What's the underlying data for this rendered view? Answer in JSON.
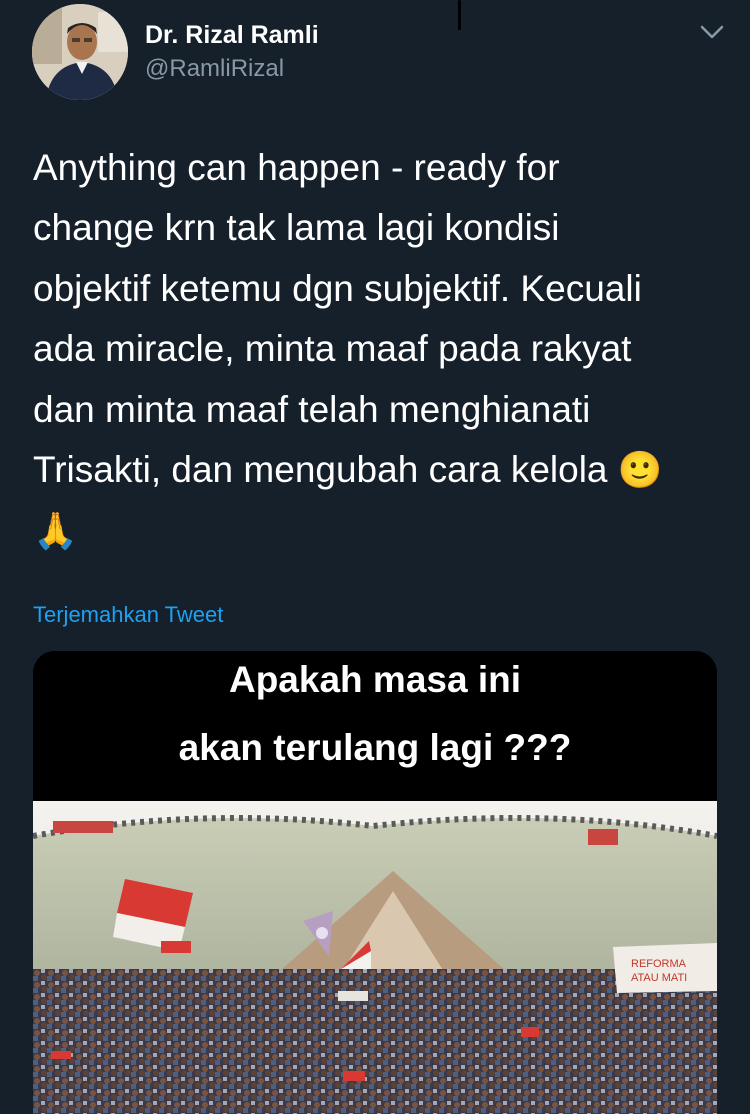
{
  "author": {
    "name": "Dr. Rizal Ramli",
    "handle": "@RamliRizal",
    "avatar_icon": "profile-photo"
  },
  "menu": {
    "icon": "chevron-down-icon"
  },
  "tweet": {
    "lines": [
      "Anything can happen - ready for",
      "change krn tak lama lagi kondisi",
      "objektif ketemu dgn subjektif. Kecuali",
      "ada miracle, minta maaf pada rakyat",
      "dan minta maaf telah menghianati",
      "Trisakti, dan mengubah cara kelola"
    ],
    "emoji_smile": "🙂",
    "emoji_pray": "🙏"
  },
  "translate_label": "Terjemahkan Tweet",
  "media": {
    "caption_line1": "Apakah masa ini",
    "caption_line2": "akan terulang lagi ???",
    "banner_text1": "REFORMA",
    "banner_text2": "ATAU MATI"
  },
  "colors": {
    "background": "#15202b",
    "secondary_text": "#8899a6",
    "link": "#1da1f2"
  }
}
